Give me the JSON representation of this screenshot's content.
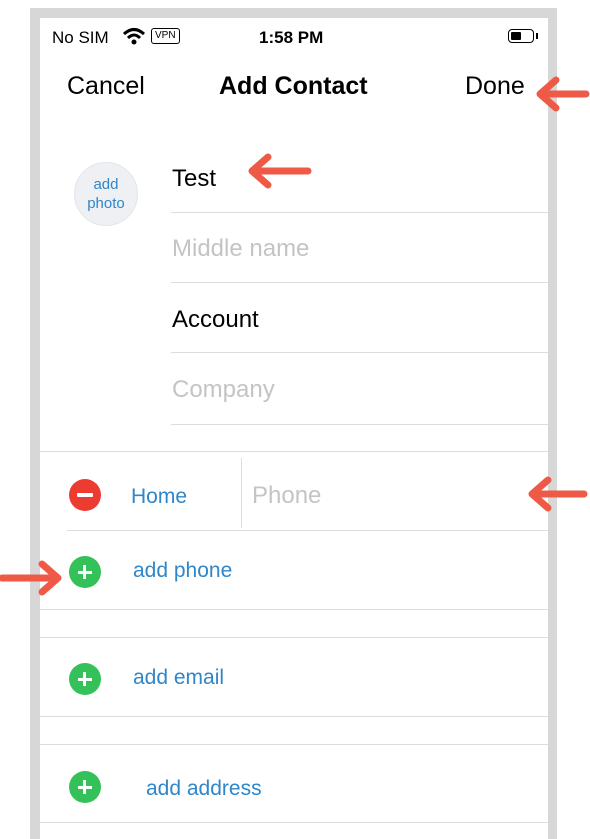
{
  "status_bar": {
    "carrier": "No SIM",
    "vpn": "VPN",
    "time": "1:58 PM"
  },
  "nav": {
    "cancel": "Cancel",
    "title": "Add Contact",
    "done": "Done"
  },
  "photo": {
    "line1": "add",
    "line2": "photo"
  },
  "name_fields": {
    "first_name_value": "Test",
    "middle_name_placeholder": "Middle name",
    "last_name_value": "Account",
    "company_placeholder": "Company"
  },
  "phone": {
    "label": "Home",
    "placeholder": "Phone"
  },
  "actions": {
    "add_phone": "add phone",
    "add_email": "add email",
    "add_address": "add address"
  },
  "colors": {
    "accent_blue": "#2f86c9",
    "delete_red": "#ec3b30",
    "add_green": "#35c159",
    "annotation_arrow": "#ef5a47"
  }
}
